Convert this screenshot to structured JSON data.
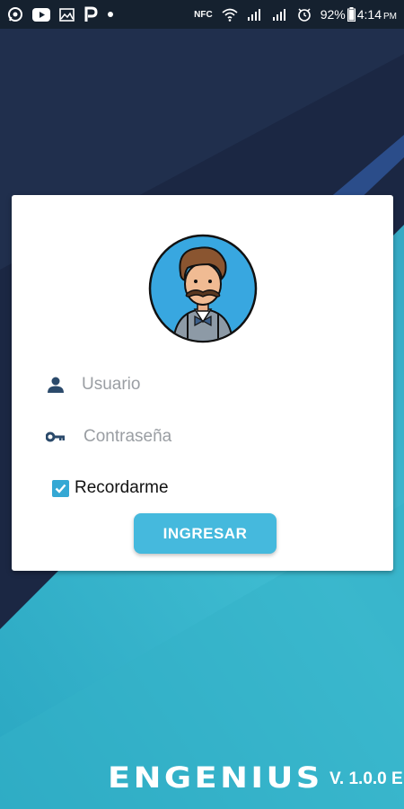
{
  "status_bar": {
    "icons_left": [
      "whatsapp-icon",
      "youtube-icon",
      "image-icon",
      "p-app-icon",
      "dot-icon"
    ],
    "nfc": "NFC",
    "battery": "92%",
    "time": "4:14",
    "ampm": "PM"
  },
  "login": {
    "username_placeholder": "Usuario",
    "password_placeholder": "Contraseña",
    "remember_label": "Recordarme",
    "remember_checked": true,
    "submit_label": "INGRESAR"
  },
  "footer": {
    "brand": "ENGENIUS",
    "version": "V. 1.0.0 E"
  },
  "colors": {
    "accent": "#45b9dd",
    "background_dark": "#1e2b47",
    "background_teal": "#35b3c9",
    "icon": "#2b4a6b"
  }
}
